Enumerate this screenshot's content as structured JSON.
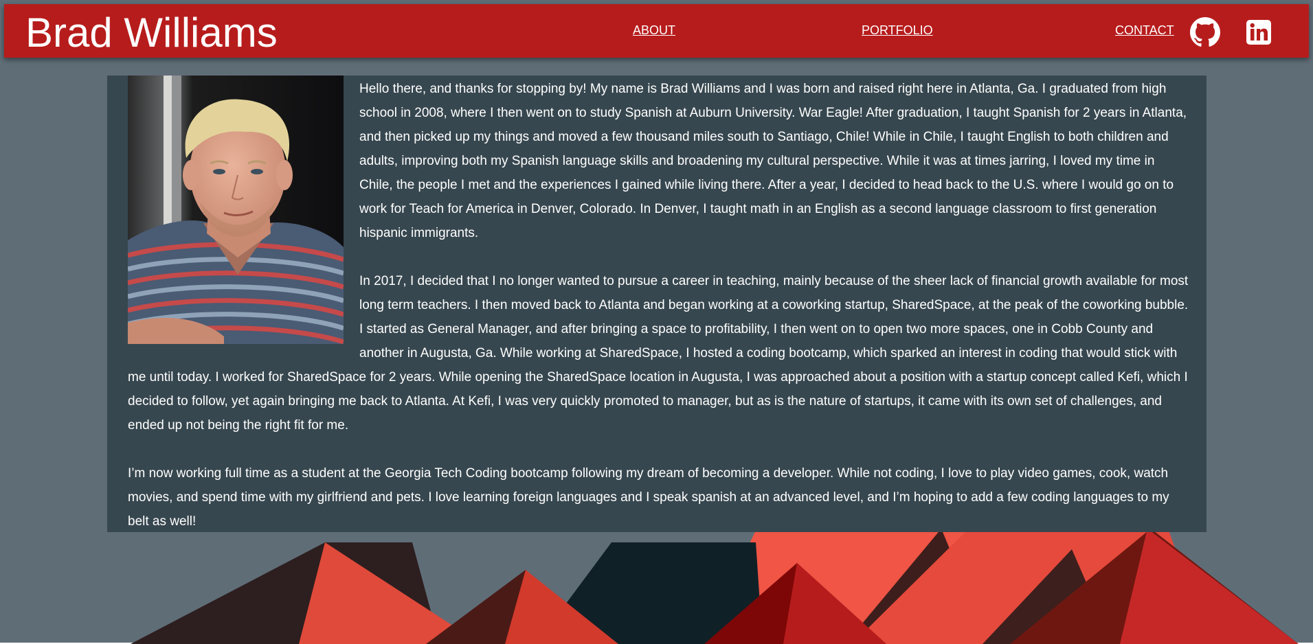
{
  "header": {
    "brand": "Brad Williams",
    "nav": {
      "about": "ABOUT",
      "portfolio": "PORTFOLIO",
      "contact": "CONTACT"
    },
    "social_icons": [
      "github-icon",
      "linkedin-icon"
    ]
  },
  "about": {
    "photo": "profile-photo",
    "paragraphs": [
      "Hello there, and thanks for stopping by! My name is Brad Williams and I was born and raised right here in Atlanta, Ga. I graduated from high school in 2008, where I then went on to study Spanish at Auburn University. War Eagle! After graduation, I taught Spanish for 2 years in Atlanta, and then picked up my things and moved a few thousand miles south to Santiago, Chile! While in Chile, I taught English to both children and adults, improving both my Spanish language skills and broadening my cultural perspective. While it was at times jarring, I loved my time in Chile, the people I met and the experiences I gained while living there. After a year, I decided to head back to the U.S. where I would go on to work for Teach for America in Denver, Colorado. In Denver, I taught math in an English as a second language classroom to first generation hispanic immigrants.",
      "In 2017, I decided that I no longer wanted to pursue a career in teaching, mainly because of the sheer lack of financial growth available for most long term teachers. I then moved back to Atlanta and began working at a coworking startup, SharedSpace, at the peak of the coworking bubble. I started as General Manager, and after bringing a space to profitability, I then went on to open two more spaces, one in Cobb County and another in Augusta, Ga. While working at SharedSpace, I hosted a coding bootcamp, which sparked an interest in coding that would stick with me until today. I worked for SharedSpace for 2 years. While opening the SharedSpace location in Augusta, I was approached about a position with a startup concept called Kefi, which I decided to follow, yet again bringing me back to Atlanta. At Kefi, I was very quickly promoted to manager, but as is the nature of startups, it came with its own set of challenges, and ended up not being the right fit for me.",
      "I’m now working full time as a student at the Georgia Tech Coding bootcamp following my dream of becoming a developer. While not coding, I love to play video games, cook, watch movies, and spend time with my girlfriend and pets. I love learning foreign languages and I speak spanish at an advanced level, and I’m hoping to add a few coding languages to my belt as well!"
    ]
  },
  "colors": {
    "header": "#b71c1c",
    "background": "#5f6d77",
    "card": "#37474f",
    "text": "#ffffff"
  }
}
